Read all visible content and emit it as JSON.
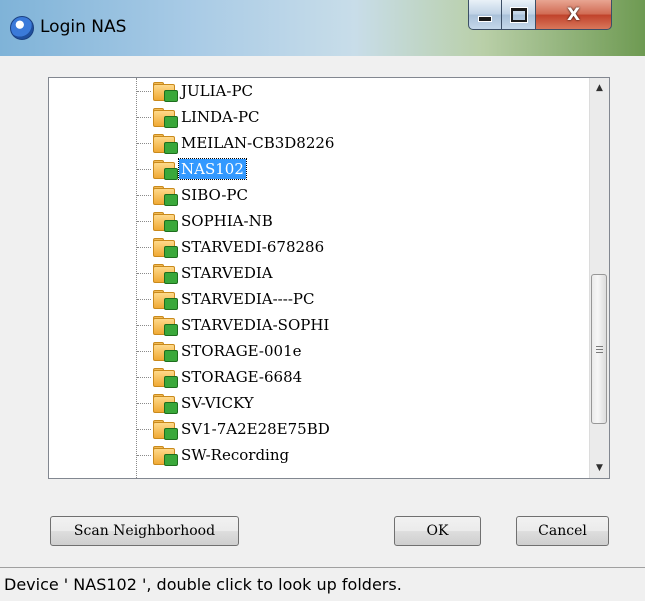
{
  "window": {
    "title": "Login NAS",
    "close_glyph": "X"
  },
  "tree": {
    "items": [
      {
        "label": "JULIA-PC",
        "icon": "network-folder-icon",
        "selected": false
      },
      {
        "label": "LINDA-PC",
        "icon": "network-folder-icon",
        "selected": false
      },
      {
        "label": "MEILAN-CB3D8226",
        "icon": "network-folder-icon",
        "selected": false
      },
      {
        "label": "NAS102",
        "icon": "network-folder-icon",
        "selected": true
      },
      {
        "label": "SIBO-PC",
        "icon": "network-folder-icon",
        "selected": false
      },
      {
        "label": "SOPHIA-NB",
        "icon": "network-folder-icon",
        "selected": false
      },
      {
        "label": "STARVEDI-678286",
        "icon": "network-folder-icon",
        "selected": false
      },
      {
        "label": "STARVEDIA",
        "icon": "network-folder-icon",
        "selected": false
      },
      {
        "label": "STARVEDIA----PC",
        "icon": "network-folder-icon",
        "selected": false
      },
      {
        "label": "STARVEDIA-SOPHI",
        "icon": "network-folder-icon",
        "selected": false
      },
      {
        "label": "STORAGE-001e",
        "icon": "network-folder-icon",
        "selected": false
      },
      {
        "label": "STORAGE-6684",
        "icon": "network-folder-icon",
        "selected": false
      },
      {
        "label": "SV-VICKY",
        "icon": "network-folder-icon",
        "selected": false
      },
      {
        "label": "SV1-7A2E28E75BD",
        "icon": "network-folder-icon",
        "selected": false
      },
      {
        "label": "SW-Recording",
        "icon": "network-folder-icon",
        "selected": false
      }
    ],
    "selection_color": "#3399ff"
  },
  "scrollbar": {
    "up_glyph": "▲",
    "down_glyph": "▼"
  },
  "buttons": {
    "scan_label": "Scan Neighborhood",
    "ok_label": "OK",
    "cancel_label": "Cancel"
  },
  "status": {
    "text": "Device ' NAS102 ', double click to look up folders."
  }
}
